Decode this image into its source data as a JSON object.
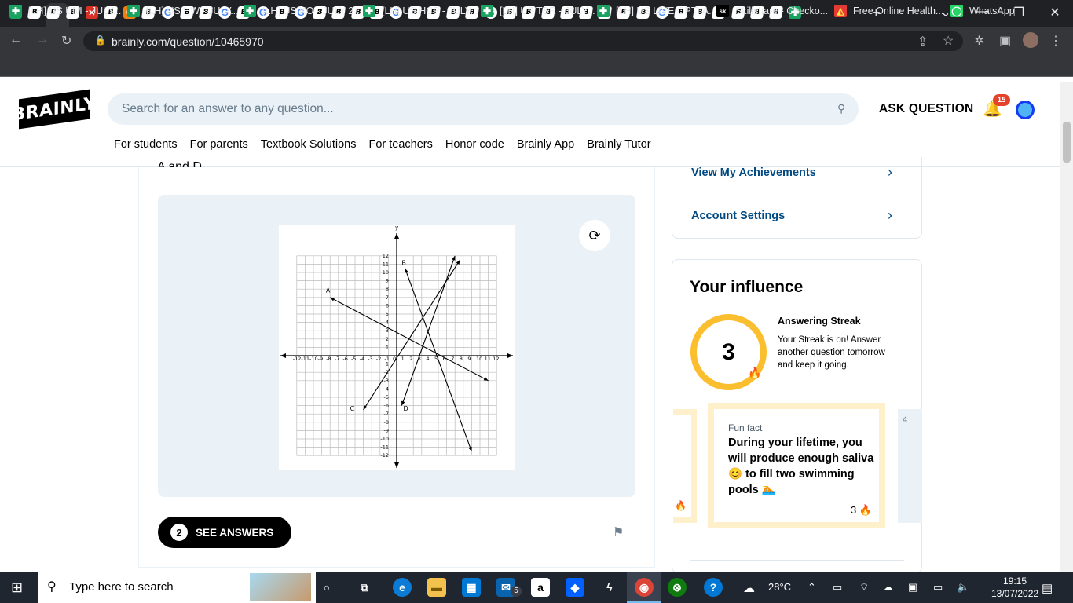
{
  "browser": {
    "url": "brainly.com/question/10465970",
    "tab_icons": [
      "sheets",
      "brainly",
      "brainly",
      "brainly",
      "brainly",
      "brainly",
      "brainly",
      "brainly",
      "google",
      "brainly",
      "brainly",
      "google",
      "brainly",
      "google",
      "brainly",
      "google",
      "brainly",
      "brainly",
      "brainly",
      "brainly",
      "google",
      "brainly",
      "brainly",
      "brainly",
      "brainly",
      "google",
      "brainly",
      "brainly",
      "brainly",
      "brainly",
      "brainly",
      "brainly",
      "brainly",
      "brainly",
      "google",
      "brainly",
      "brainly",
      "brainly",
      "brainly",
      "brainly",
      "brainly",
      "sheets"
    ],
    "bookmarks": [
      {
        "label": "[LH] US UNI - JULY...",
        "icon": "sheets"
      },
      {
        "label": "[LH] US HW - JULY...",
        "icon": "sheets"
      },
      {
        "label": "[LH] US KO - JULY 2...",
        "icon": "sheets"
      },
      {
        "label": "[LH] US HCP - JULY...",
        "icon": "sheets"
      },
      {
        "label": "[LH] US TSR - JULY...",
        "icon": "sheets"
      },
      {
        "label": "[LH] US LIVE OPTI A...",
        "icon": "sheets"
      },
      {
        "label": "Skillshare - Checko...",
        "icon": "sk"
      },
      {
        "label": "Free Online Health...",
        "icon": "health"
      },
      {
        "label": "WhatsApp",
        "icon": "whatsapp"
      }
    ]
  },
  "header": {
    "logo": "BRAINLY",
    "search_placeholder": "Search for an answer to any question...",
    "ask_label": "ASK QUESTION",
    "notifications": "15",
    "nav": [
      "For students",
      "For parents",
      "Textbook Solutions",
      "For teachers",
      "Honor code",
      "Brainly App",
      "Brainly Tutor"
    ]
  },
  "question": {
    "cut_text": "A and D",
    "see_answers_count": "2",
    "see_answers_label": "SEE ANSWERS"
  },
  "graph": {
    "x_ticks": [
      "-12",
      "-11",
      "-10",
      "-9",
      "-8",
      "-7",
      "-6",
      "-5",
      "-4",
      "-3",
      "-2",
      "-1",
      "0",
      "1",
      "2",
      "3",
      "4",
      "5",
      "6",
      "7",
      "8",
      "9",
      "10",
      "11",
      "12"
    ],
    "y_ticks": [
      "12",
      "11",
      "10",
      "9",
      "8",
      "7",
      "6",
      "5",
      "4",
      "3",
      "2",
      "1",
      "-1",
      "-2",
      "-3",
      "-4",
      "-5",
      "-6",
      "-7",
      "-8",
      "-9",
      "-10",
      "-11",
      "-12"
    ],
    "y_axis_label": "y",
    "line_labels": [
      "A",
      "B",
      "C",
      "D"
    ]
  },
  "sidebar": {
    "achievements": "View My Achievements",
    "settings": "Account Settings",
    "influence_title": "Your influence",
    "streak_number": "3",
    "streak_title": "Answering Streak",
    "streak_desc": "Your Streak is on! Answer another question tomorrow and keep it going.",
    "fun_label": "Fun fact",
    "fun_text": "During your lifetime, you will produce enough saliva 😊 to fill two swimming pools 🏊",
    "fun_count": "3",
    "next_card_num": "4"
  },
  "taskbar": {
    "search_placeholder": "Type here to search",
    "mail_badge": "5",
    "weather": "28°C",
    "time": "19:15",
    "date": "13/07/2022"
  }
}
